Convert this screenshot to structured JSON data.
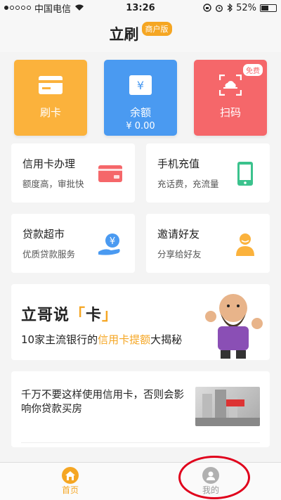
{
  "status": {
    "carrier": "中国电信",
    "time": "13:26",
    "battery": "52%"
  },
  "header": {
    "title": "立刷",
    "badge": "商户版"
  },
  "quick_actions": [
    {
      "label": "刷卡"
    },
    {
      "label": "余额",
      "sub": "¥ 0.00"
    },
    {
      "label": "扫码",
      "badge": "免费"
    }
  ],
  "tiles": [
    {
      "title": "信用卡办理",
      "sub": "额度高，审批快"
    },
    {
      "title": "手机充值",
      "sub": "充话费，充流量"
    },
    {
      "title": "贷款超市",
      "sub": "优质贷款服务"
    },
    {
      "title": "邀请好友",
      "sub": "分享给好友"
    }
  ],
  "banner": {
    "title_a": "立哥说",
    "title_q1": "「",
    "title_k": "卡",
    "title_q2": "」",
    "sub_a": "10家主流银行的",
    "sub_hl": "信用卡提额",
    "sub_b": "大揭秘"
  },
  "article": {
    "text": "千万不要这样使用信用卡，否则会影响你贷款买房"
  },
  "tabbar": {
    "home": "首页",
    "mine": "我的"
  },
  "colors": {
    "accent": "#f5a623",
    "blue": "#4a9af1",
    "red": "#f5676a",
    "annotation": "#e0001b"
  }
}
